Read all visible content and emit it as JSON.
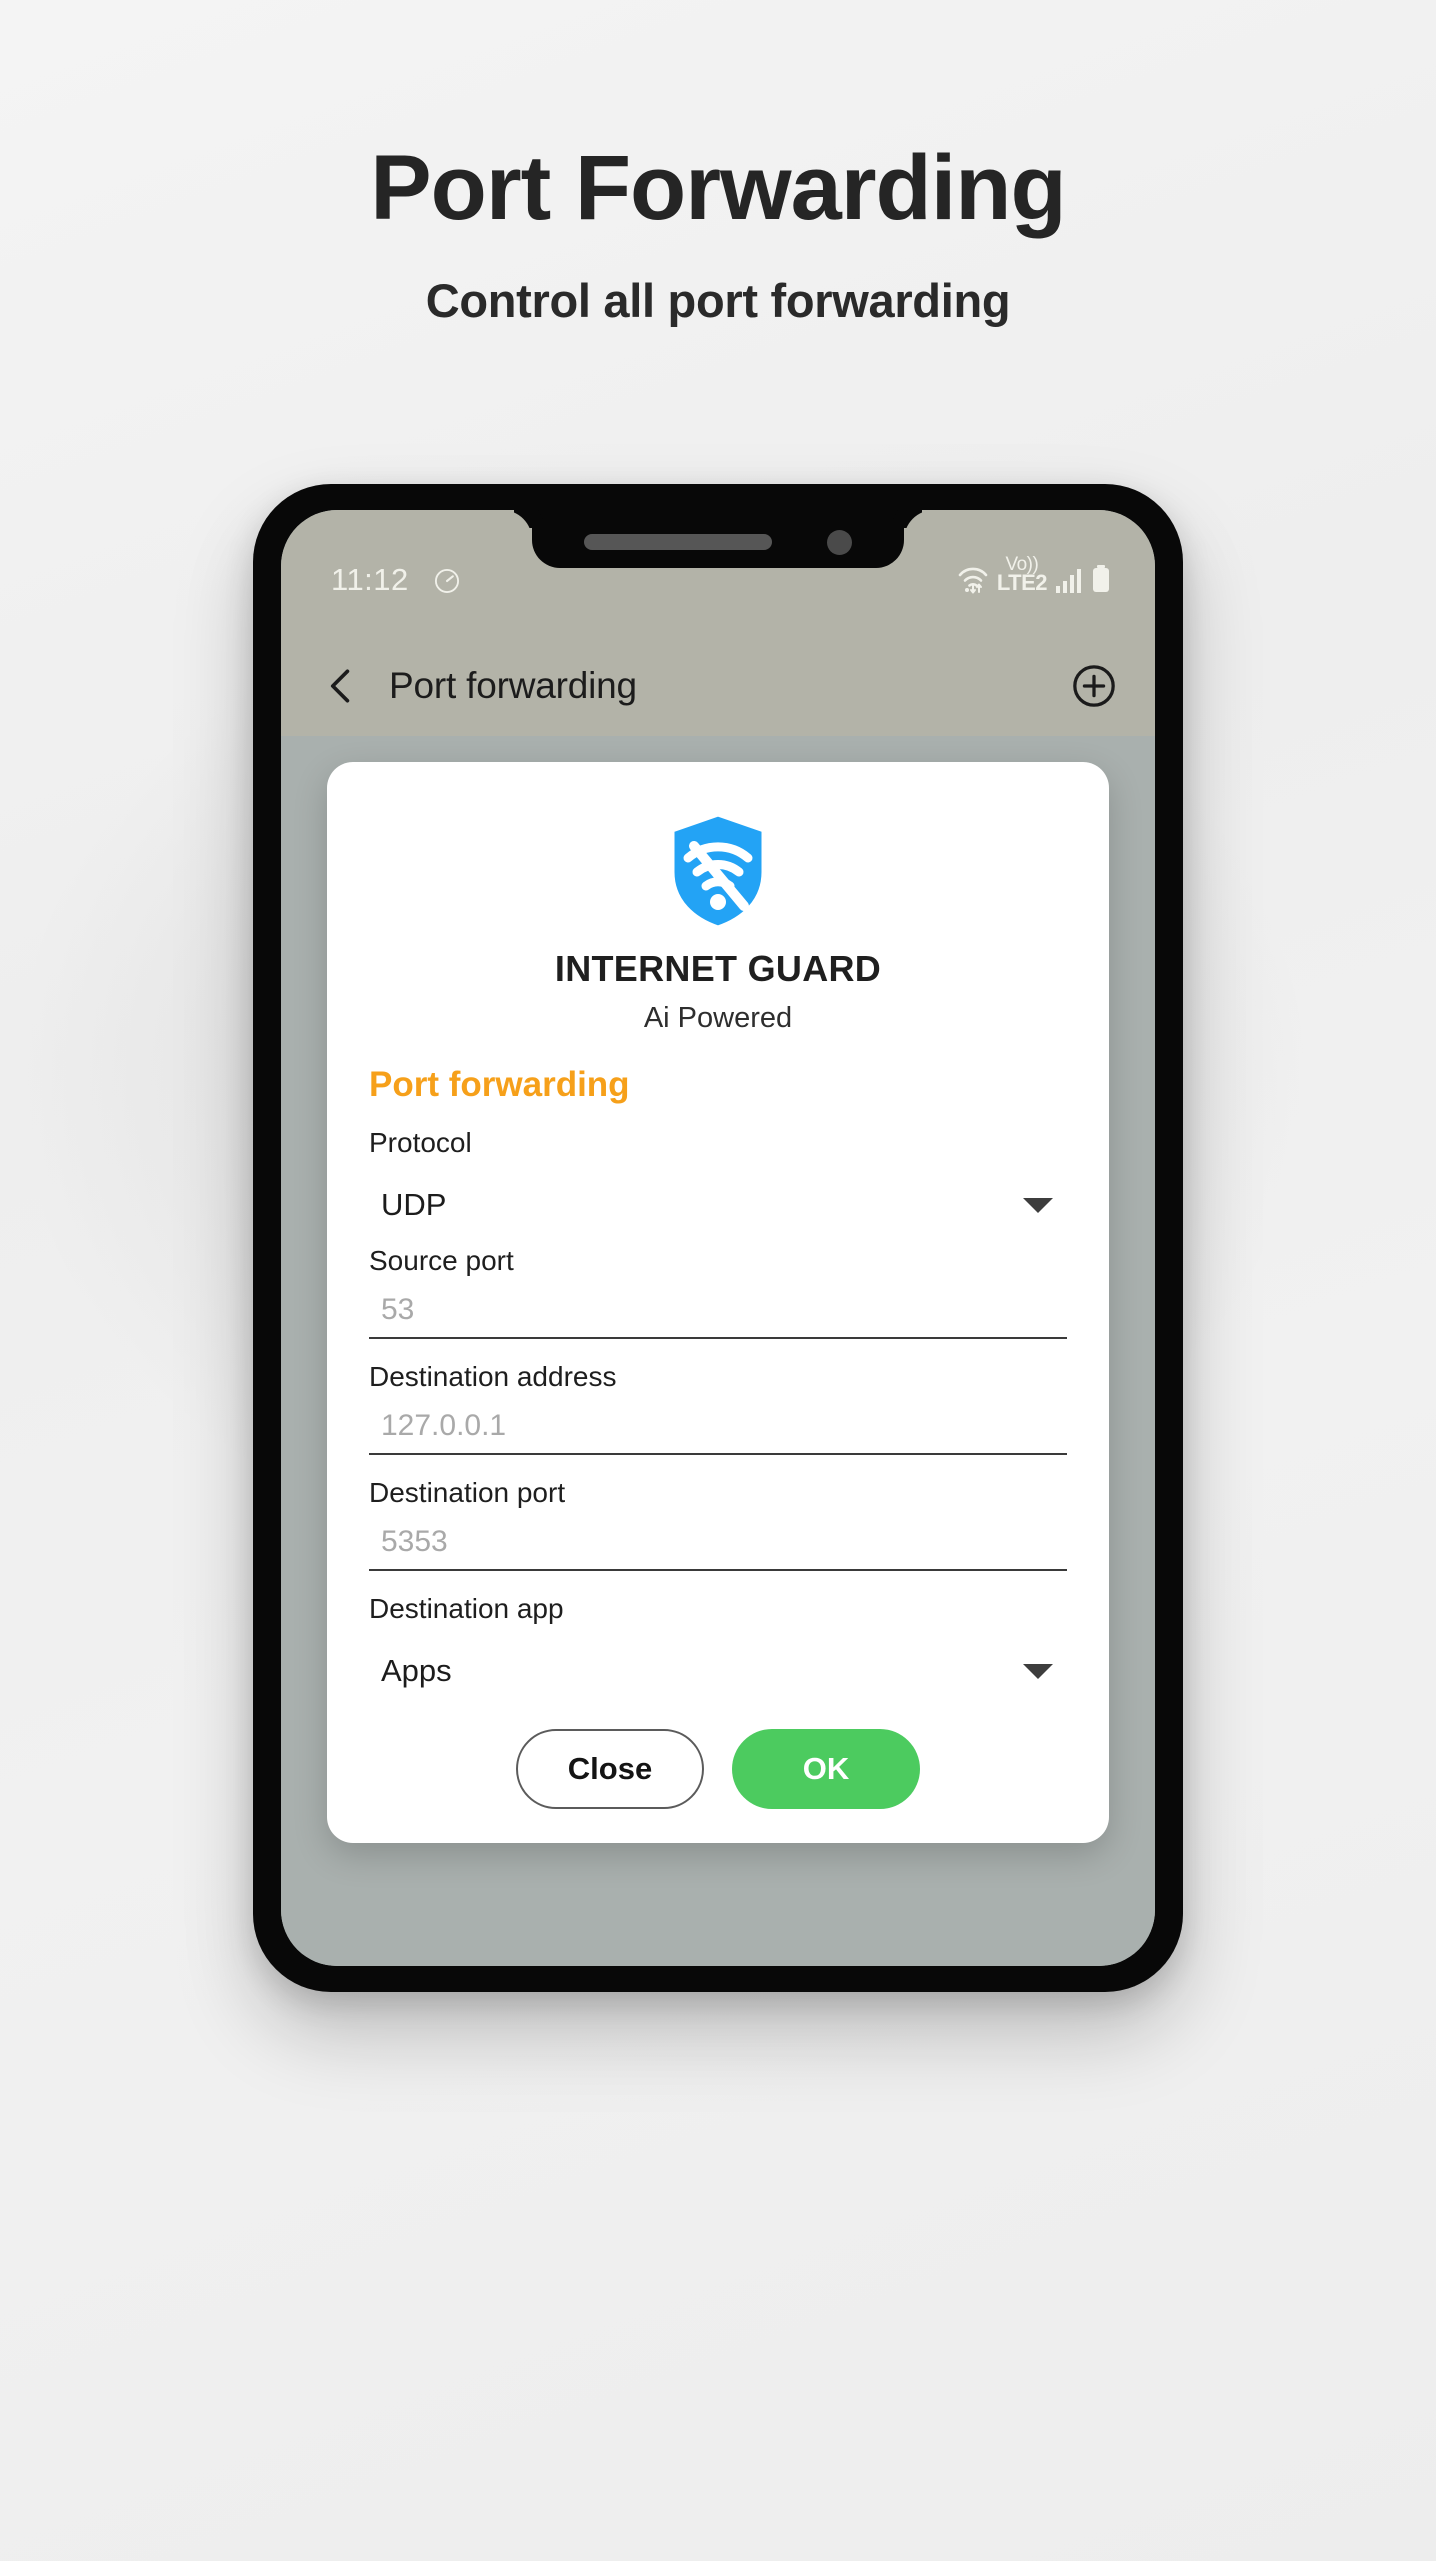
{
  "promo": {
    "title": "Port Forwarding",
    "subtitle": "Control all port forwarding"
  },
  "colors": {
    "accent_orange": "#f6a01a",
    "ok_green": "#4ccb5f",
    "shield_blue": "#2196f3",
    "screen_bg": "#a9b0ae",
    "bar_bg": "#b3b3a8"
  },
  "status_bar": {
    "time": "11:12",
    "data_saver_icon": "speedometer-icon",
    "wifi_icon": "wifi-transfer-icon",
    "volte_top": "Vo))",
    "volte_bottom": "LTE2",
    "signal_icon": "signal-bars-icon",
    "battery_icon": "battery-full-icon"
  },
  "app_bar": {
    "back_icon": "chevron-left-icon",
    "title": "Port forwarding",
    "add_icon": "plus-circle-icon"
  },
  "dialog": {
    "logo_icon": "shield-wifi-off-icon",
    "brand_name": "INTERNET GUARD",
    "brand_tagline": "Ai Powered",
    "title": "Port forwarding",
    "fields": [
      {
        "label": "Protocol",
        "type": "spinner",
        "value": "UDP",
        "caret_icon": "chevron-down-icon"
      },
      {
        "label": "Source port",
        "type": "input",
        "placeholder": "53"
      },
      {
        "label": "Destination address",
        "type": "input",
        "placeholder": "127.0.0.1"
      },
      {
        "label": "Destination port",
        "type": "input",
        "placeholder": "5353"
      },
      {
        "label": "Destination app",
        "type": "spinner",
        "value": "Apps",
        "caret_icon": "chevron-down-icon"
      }
    ],
    "buttons": {
      "close": "Close",
      "ok": "OK"
    }
  },
  "nav_bar": {
    "recents_icon": "recents-icon",
    "home_icon": "home-icon",
    "back_icon": "chevron-left-icon"
  }
}
